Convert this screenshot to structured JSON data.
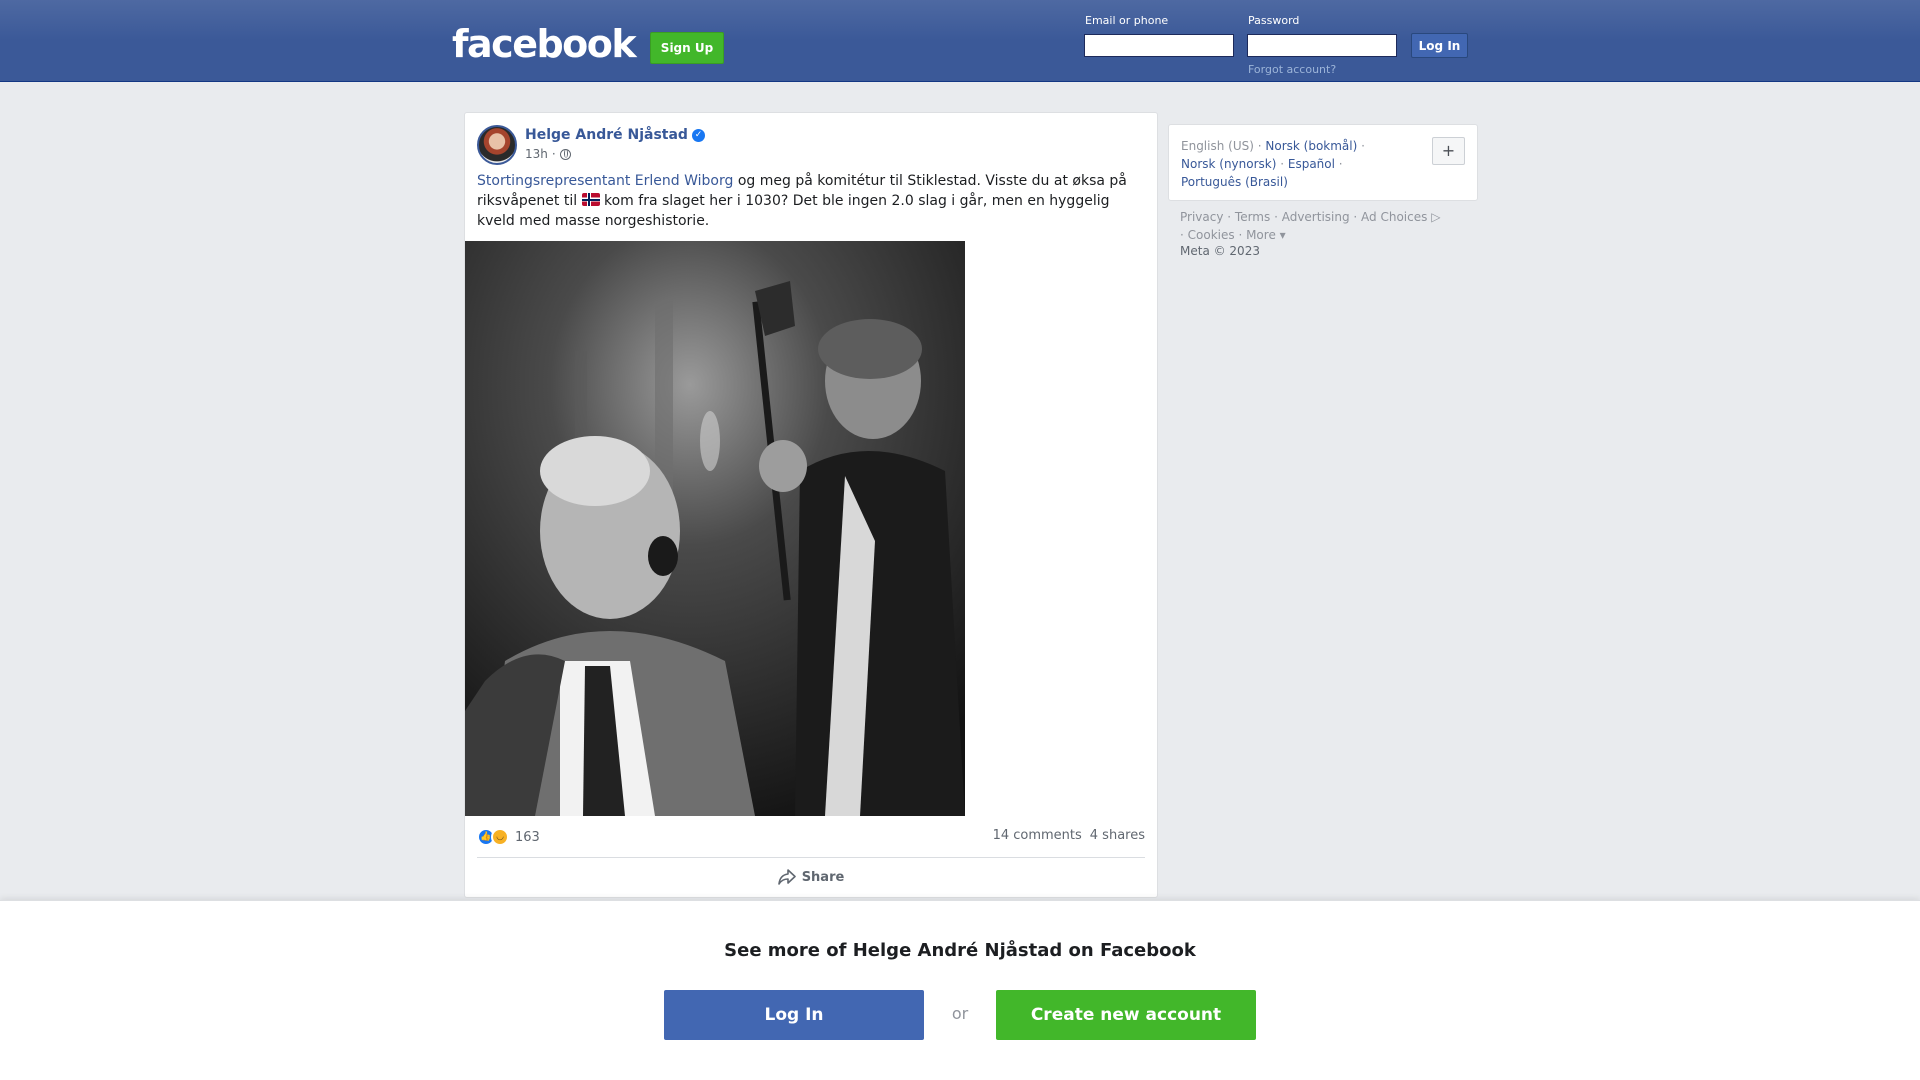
{
  "header": {
    "logo": "facebook",
    "signup_label": "Sign Up",
    "email_label": "Email or phone",
    "email_value": "",
    "password_label": "Password",
    "password_value": "",
    "login_label": "Log In",
    "forgot_label": "Forgot account?",
    "bar_color": "#3b5998"
  },
  "post": {
    "author": "Helge André Njåstad",
    "time": "13h",
    "separator": "·",
    "mention": "Stortingsrepresentant Erlend Wiborg",
    "text_part1": " og meg på komitétur til Stiklestad. Visste du at øksa på riksvåpenet til ",
    "text_part2": " kom fra slaget her i 1030? Det ble ingen 2.0 slag i går, men en hyggelig kveld med masse norgeshistorie.",
    "flag_icon": "norway-flag-icon",
    "reaction_count": "163",
    "comments": "14 comments",
    "shares": "4 shares",
    "share_label": "Share"
  },
  "sidebar": {
    "languages": {
      "current": "English (US)",
      "options": [
        "Norsk (bokmål)",
        "Norsk (nynorsk)",
        "Español",
        "Português (Brasil)"
      ]
    },
    "add_language_icon": "plus-icon",
    "footer_links": [
      "Privacy",
      "Terms",
      "Advertising",
      "Ad Choices",
      "Cookies",
      "More"
    ],
    "copyright": "Meta © 2023"
  },
  "banner": {
    "title": "See more of Helge André Njåstad on Facebook",
    "login_label": "Log In",
    "or_label": "or",
    "create_label": "Create new account"
  }
}
